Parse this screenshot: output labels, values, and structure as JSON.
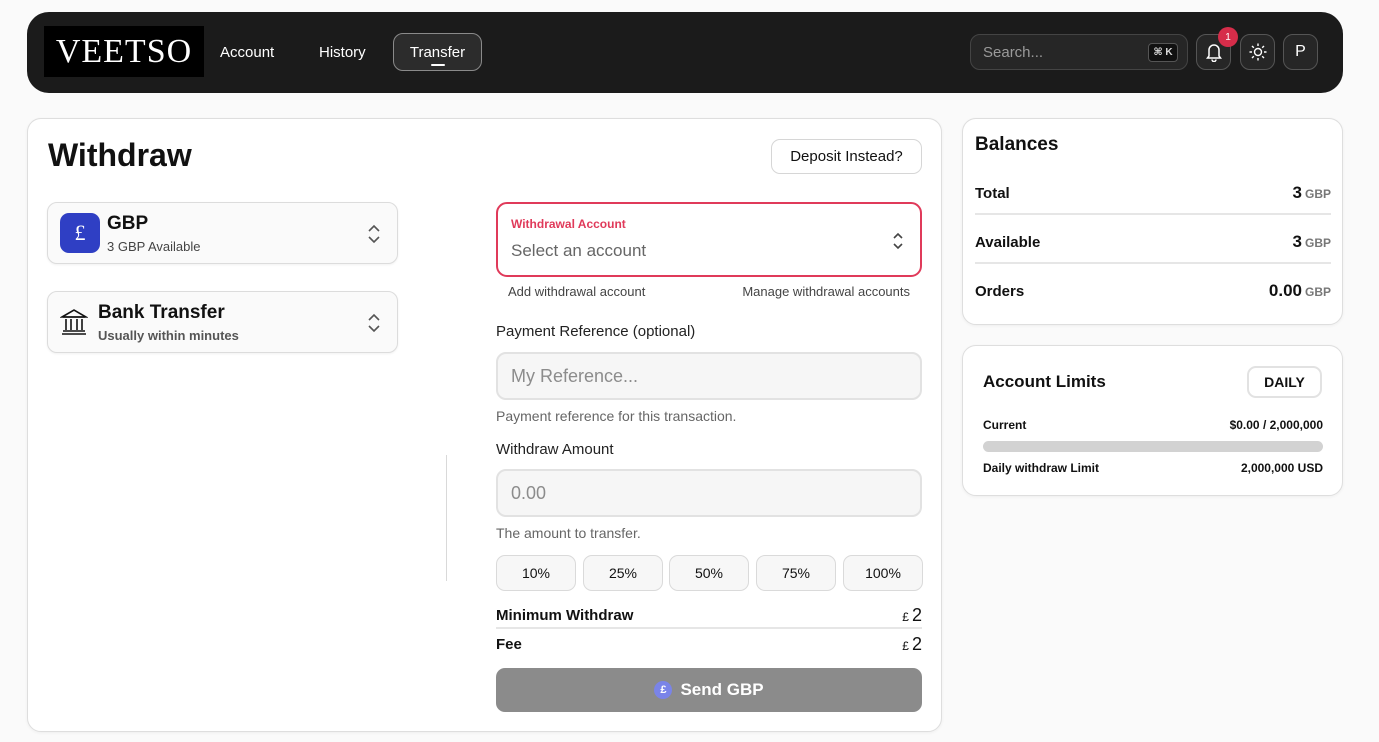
{
  "header": {
    "logo_text": "VEETSO",
    "nav": [
      {
        "label": "Account"
      },
      {
        "label": "History"
      },
      {
        "label": "Transfer"
      }
    ],
    "search": {
      "placeholder": "Search...",
      "shortcut": "⌘ K"
    },
    "notifications_count": "1",
    "avatar_initial": "P"
  },
  "main": {
    "title": "Withdraw",
    "deposit_button": "Deposit Instead?",
    "currency": {
      "code": "GBP",
      "symbol": "£",
      "available": "3 GBP Available",
      "icon_color": "#2f3fc4"
    },
    "method": {
      "title": "Bank Transfer",
      "subtitle": "Usually within minutes",
      "icon": "bank-icon"
    },
    "withdrawal_account": {
      "label": "Withdrawal Account",
      "value": "Select an account",
      "accent": "#e03a5a"
    },
    "add_account_link": "Add withdrawal account",
    "manage_accounts_link": "Manage withdrawal accounts",
    "reference": {
      "label": "Payment Reference (optional)",
      "placeholder": "My Reference...",
      "helper": "Payment reference for this transaction."
    },
    "amount": {
      "label": "Withdraw Amount",
      "placeholder": "0.00",
      "helper": "The amount to transfer."
    },
    "percent_buttons": [
      "10%",
      "25%",
      "50%",
      "75%",
      "100%"
    ],
    "minimum": {
      "label": "Minimum Withdraw",
      "symbol": "£",
      "value": "2"
    },
    "fee": {
      "label": "Fee",
      "symbol": "£",
      "value": "2"
    },
    "send_button": {
      "label": "Send GBP",
      "coin_symbol": "£"
    }
  },
  "balances": {
    "title": "Balances",
    "rows": [
      {
        "label": "Total",
        "value": "3",
        "unit": "GBP"
      },
      {
        "label": "Available",
        "value": "3",
        "unit": "GBP"
      },
      {
        "label": "Orders",
        "value": "0.00",
        "unit": "GBP"
      }
    ]
  },
  "limits": {
    "title": "Account Limits",
    "period_button": "DAILY",
    "current_label": "Current",
    "current_value": "$0.00 / 2,000,000",
    "progress_fraction": 0,
    "limit_label": "Daily withdraw Limit",
    "limit_value": "2,000,000 USD"
  }
}
